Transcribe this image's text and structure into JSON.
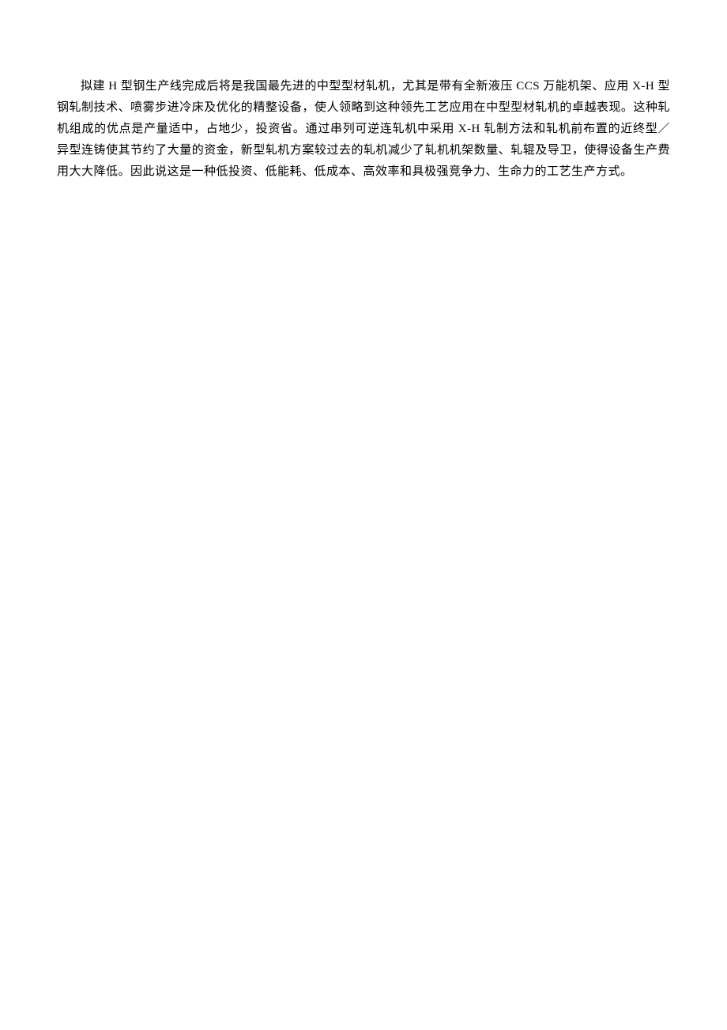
{
  "document": {
    "paragraph": "拟建 H 型钢生产线完成后将是我国最先进的中型型材轧机，尤其是带有全新液压 CCS 万能机架、应用 X-H 型钢轧制技术、喷雾步进冷床及优化的精整设备，使人领略到这种领先工艺应用在中型型材轧机的卓越表现。这种轧机组成的优点是产量适中，占地少，投资省。通过串列可逆连轧机中采用 X-H 轧制方法和轧机前布置的近终型／异型连铸使其节约了大量的资金，新型轧机方案较过去的轧机减少了轧机机架数量、轧辊及导卫，使得设备生产费用大大降低。因此说这是一种低投资、低能耗、低成本、高效率和具极强竞争力、生命力的工艺生产方式。"
  }
}
